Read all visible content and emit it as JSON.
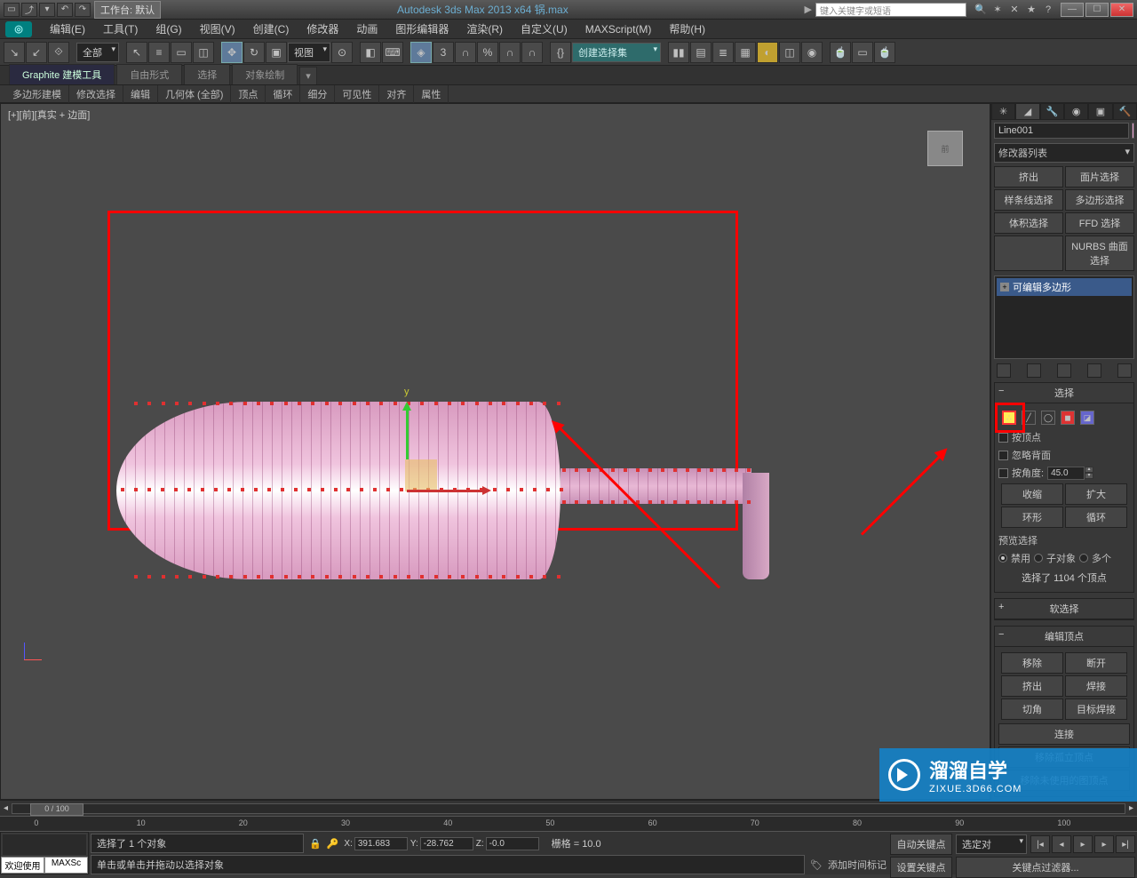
{
  "app": {
    "title": "Autodesk 3ds Max  2013 x64    锅.max",
    "workspace": "工作台: 默认",
    "search_placeholder": "键入关键字或短语"
  },
  "menu": [
    "编辑(E)",
    "工具(T)",
    "组(G)",
    "视图(V)",
    "创建(C)",
    "修改器",
    "动画",
    "图形编辑器",
    "渲染(R)",
    "自定义(U)",
    "MAXScript(M)",
    "帮助(H)"
  ],
  "toolbar": {
    "sel_filter": "全部",
    "ref_coord": "视图",
    "create_set_placeholder": "创建选择集"
  },
  "ribbon": {
    "tabs": [
      "Graphite 建模工具",
      "自由形式",
      "选择",
      "对象绘制"
    ],
    "subs": [
      "多边形建模",
      "修改选择",
      "编辑",
      "几何体 (全部)",
      "顶点",
      "循环",
      "细分",
      "可见性",
      "对齐",
      "属性"
    ]
  },
  "viewport": {
    "label": "[+][前][真实 + 边面]"
  },
  "modify": {
    "object": "Line001",
    "mod_list_label": "修改器列表",
    "buttons": [
      "挤出",
      "面片选择",
      "样条线选择",
      "多边形选择",
      "体积选择",
      "FFD 选择",
      "",
      "NURBS 曲面选择"
    ],
    "stack": "可编辑多边形",
    "selection": {
      "title": "选择",
      "by_vertex": "按顶点",
      "ignore_back": "忽略背面",
      "by_angle": "按角度:",
      "angle": "45.0",
      "shrink": "收缩",
      "grow": "扩大",
      "ring": "环形",
      "loop": "循环",
      "preview": "预览选择",
      "r_disable": "禁用",
      "r_sub": "子对象",
      "r_multi": "多个",
      "count": "选择了 1104 个顶点"
    },
    "soft": "软选择",
    "edit_vtx": {
      "title": "编辑顶点",
      "remove": "移除",
      "break": "断开",
      "extrude": "挤出",
      "weld": "焊接",
      "chamfer": "切角",
      "target": "目标焊接",
      "connect": "连接",
      "rem_iso": "移除孤立顶点",
      "rem_unused": "移除未使用的图顶点"
    }
  },
  "status": {
    "frame": "0 / 100",
    "welcome": "欢迎使用",
    "script": "MAXSc",
    "line1": "选择了 1 个对象",
    "line2": "单击或单击并拖动以选择对象",
    "x": "391.683",
    "y": "-28.762",
    "z": "-0.0",
    "grid": "栅格 = 10.0",
    "add_marker": "添加时间标记",
    "auto_key": "自动关键点",
    "set_key": "设置关键点",
    "sel_label": "选定对",
    "key_filter": "关键点过滤器..."
  },
  "watermark": {
    "brand": "溜溜自学",
    "url": "ZIXUE.3D66.COM"
  }
}
